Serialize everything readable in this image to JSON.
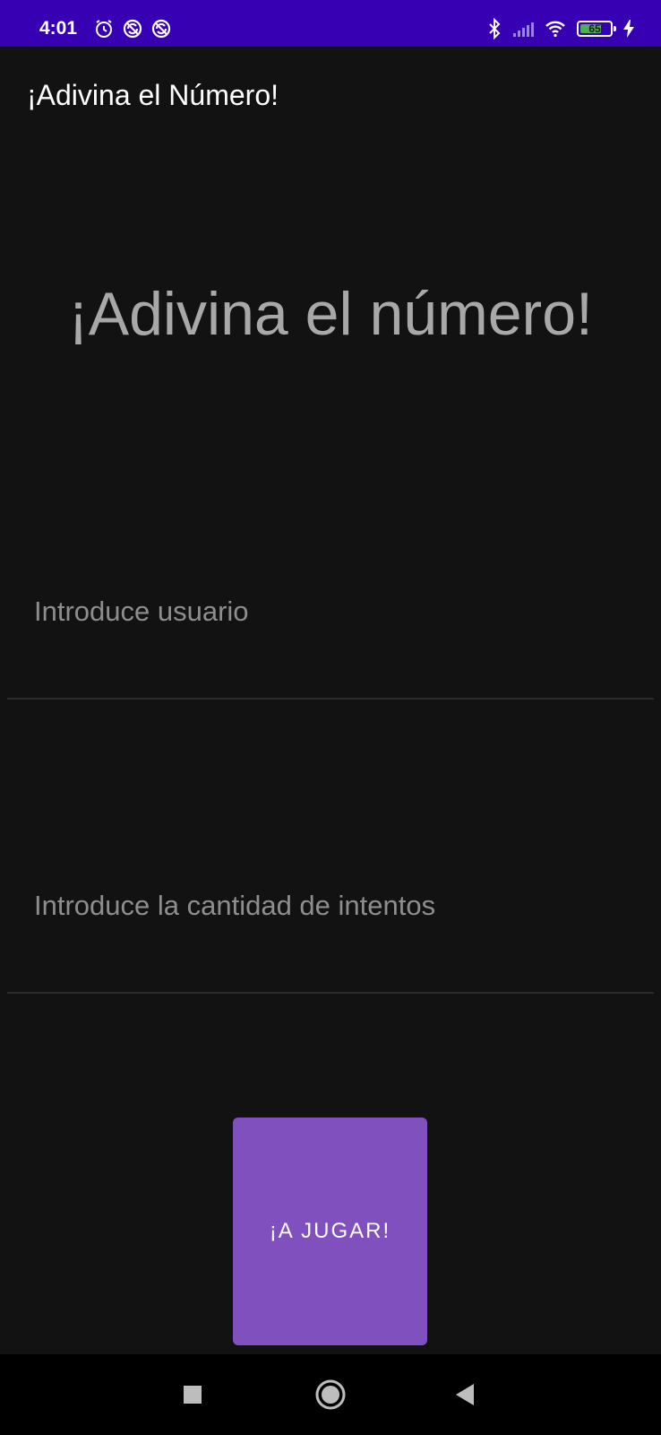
{
  "status_bar": {
    "time": "4:01",
    "left_icons": [
      "alarm-icon",
      "no-disturb-icon",
      "no-disturb-icon"
    ],
    "right_icons": [
      "bluetooth-icon",
      "signal-icon",
      "wifi-icon",
      "battery-icon",
      "charging-icon"
    ],
    "battery_level": "65",
    "background_color": "#3700b3"
  },
  "app_bar": {
    "title": "¡Adivina el Número!"
  },
  "main": {
    "headline": "¡Adivina el número!",
    "user_field": {
      "placeholder": "Introduce usuario",
      "value": ""
    },
    "attempts_field": {
      "placeholder": "Introduce la cantidad de intentos",
      "value": ""
    },
    "play_button": {
      "label": "¡A JUGAR!",
      "color": "#7f50be"
    }
  },
  "nav_bar": {
    "buttons": [
      "recents-icon",
      "home-icon",
      "back-icon"
    ]
  },
  "colors": {
    "background": "#121212",
    "accent": "#7f50be",
    "status_bar": "#3700b3"
  }
}
